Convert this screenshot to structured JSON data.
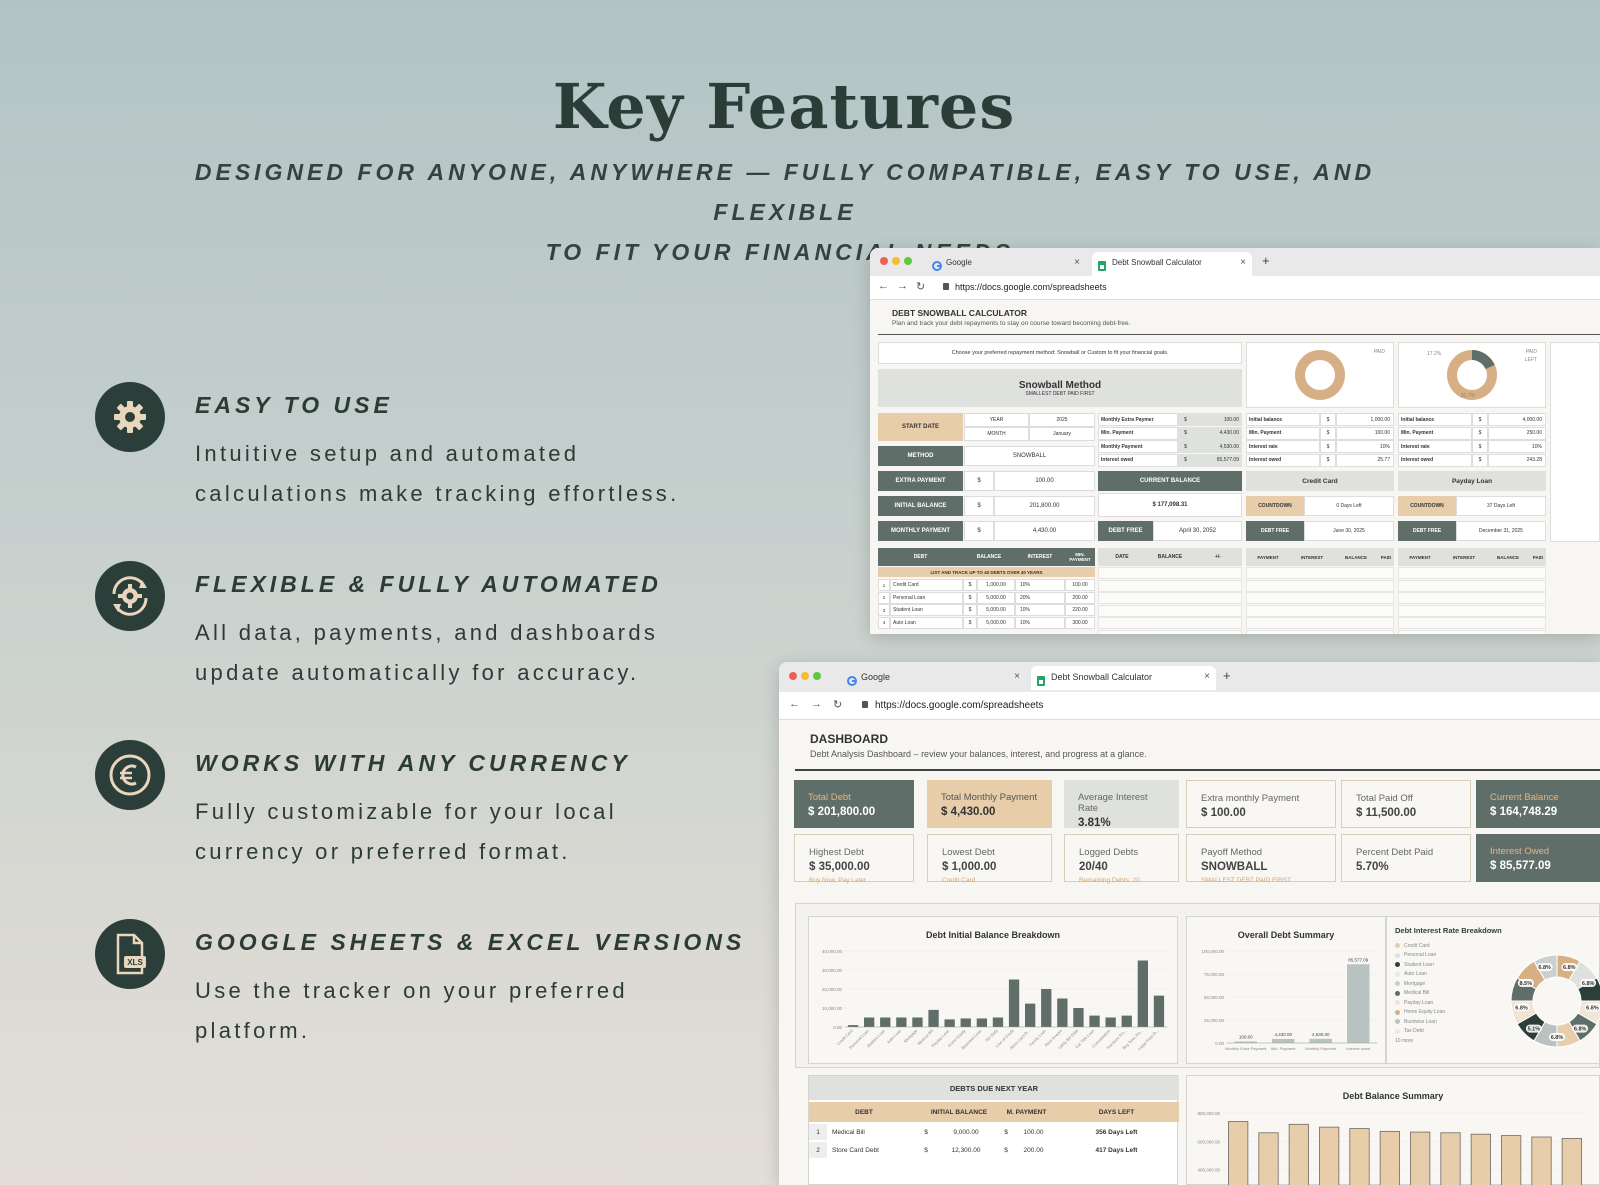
{
  "header": {
    "title": "Key Features",
    "subtitle_line1": "DESIGNED FOR ANYONE, ANYWHERE — FULLY COMPATIBLE, EASY TO USE, AND FLEXIBLE",
    "subtitle_line2": "TO FIT YOUR FINANCIAL NEEDS."
  },
  "features": [
    {
      "icon": "gear-icon",
      "title": "EASY TO USE",
      "line1": "Intuitive setup and automated",
      "line2": "calculations make tracking effortless."
    },
    {
      "icon": "refresh-gear-icon",
      "title": "FLEXIBLE & FULLY AUTOMATED",
      "line1": "All data, payments, and dashboards",
      "line2": "update automatically for accuracy."
    },
    {
      "icon": "euro-icon",
      "title": "WORKS WITH ANY CURRENCY",
      "line1": "Fully customizable for your local",
      "line2": "currency or preferred format."
    },
    {
      "icon": "xls-file-icon",
      "title": "GOOGLE SHEETS & EXCEL VERSIONS",
      "line1": "Use the tracker on your preferred",
      "line2": "platform.",
      "badge": "XLS"
    }
  ],
  "browser": {
    "tab1": "Google",
    "tab2": "Debt Snowball Calculator",
    "url": "https://docs.google.com/spreadsheets"
  },
  "calculator": {
    "title": "DEBT SNOWBALL CALCULATOR",
    "subtitle": "Plan and track your debt repayments to stay on course toward becoming debt-free.",
    "choose_text": "Choose your preferred repayment method: Snowball or Custom to fit your financial goals.",
    "method_title": "Snowball Method",
    "method_sub": "SMALLEST DEBT PAID FIRST",
    "start_date": "START DATE",
    "year_label": "YEAR",
    "year_val": "2025",
    "month_label": "MONTH",
    "month_val": "January",
    "method_label": "METHOD",
    "method_val": "SNOWBALL",
    "extra_payment": "EXTRA PAYMENT",
    "extra_val": "100.00",
    "initial_balance": "INITIAL BALANCE",
    "initial_val": "201,800.00",
    "monthly_payment": "MONTHLY PAYMENT",
    "monthly_val": "4,430.00",
    "currency": "$",
    "summary": [
      {
        "label": "Monthly Extra Paymer",
        "value": "100.00"
      },
      {
        "label": "Min. Payment",
        "value": "4,430.00"
      },
      {
        "label": "Monthly Payment",
        "value": "4,530.00"
      },
      {
        "label": "Interest owed",
        "value": "85,577.09"
      }
    ],
    "current_balance": "CURRENT BALANCE",
    "current_val": "$ 177,098.31",
    "debt_free": "DEBT FREE",
    "debt_free_val": "April 30, 2052",
    "cards": [
      {
        "name": "Credit Card",
        "countdown": "0 Days Left",
        "debt_free": "June 30, 2025",
        "rows": [
          [
            "Initial balance",
            "1,000.00"
          ],
          [
            "Min. Payment",
            "100.00"
          ],
          [
            "Interest rate",
            "10%"
          ],
          [
            "Interest owed",
            "25.77"
          ]
        ]
      },
      {
        "name": "Payday Loan",
        "countdown": "37 Days Left",
        "debt_free": "December 31, 2025",
        "rows": [
          [
            "Initial balance",
            "4,000.00"
          ],
          [
            "Min. Payment",
            "250.00"
          ],
          [
            "Interest rate",
            "10%"
          ],
          [
            "Interest owed",
            "243.28"
          ]
        ]
      }
    ],
    "countdown_label": "COUNTDOWN",
    "legend_paid": "PAID",
    "legend_left": "LEFT",
    "donut_left_pct": "17.2%",
    "donut_paid_pct": "82.7%",
    "debt_table_headers": [
      "DEBT",
      "BALANCE",
      "INTEREST",
      "MIN. PAYMENT"
    ],
    "debt_table_note": "LIST AND TRACK UP TO 40 DEBTS OVER 40 YEARS",
    "debts": [
      {
        "n": "1",
        "name": "Credit Card",
        "bal": "1,000.00",
        "rate": "10%",
        "min": "100.00"
      },
      {
        "n": "2",
        "name": "Personal Loan",
        "bal": "5,000.00",
        "rate": "20%",
        "min": "200.00"
      },
      {
        "n": "3",
        "name": "Student Loan",
        "bal": "5,000.00",
        "rate": "10%",
        "min": "220.00"
      },
      {
        "n": "4",
        "name": "Auto Loan",
        "bal": "5,000.00",
        "rate": "10%",
        "min": "300.00"
      }
    ],
    "sched_headers": [
      "DATE",
      "BALANCE",
      "+/-"
    ],
    "pay_headers": [
      "PAYMENT",
      "INTEREST",
      "BALANCE",
      "PAID"
    ]
  },
  "dashboard": {
    "title": "DASHBOARD",
    "subtitle": "Debt Analysis Dashboard – review your balances, interest, and progress at a glance.",
    "kpis_row1": [
      {
        "label": "Total Debt",
        "value": "$ 201,800.00",
        "style": "dk"
      },
      {
        "label": "Total Monthly Payment",
        "value": "$ 4,430.00",
        "style": "tan"
      },
      {
        "label": "Average Interest Rate",
        "value": "3.81%",
        "style": "gry"
      },
      {
        "label": "Extra monthly Payment",
        "value": "$ 100.00",
        "style": "lt"
      },
      {
        "label": "Total Paid Off",
        "value": "$ 11,500.00",
        "style": "lt"
      },
      {
        "label": "Current Balance",
        "value": "$ 164,748.29",
        "style": "dk"
      }
    ],
    "kpis_row2": [
      {
        "label": "Highest Debt",
        "value": "$ 35,000.00",
        "sub": "Buy Now, Pay Later",
        "style": "lt"
      },
      {
        "label": "Lowest Debt",
        "value": "$ 1,000.00",
        "sub": "Credit Card",
        "style": "lt"
      },
      {
        "label": "Logged Debts",
        "value": "20/40",
        "sub": "Remaining Debts: 20",
        "style": "lt"
      },
      {
        "label": "Payoff Method",
        "value": "SNOWBALL",
        "sub": "SMALLEST DEBT PAID FIRST",
        "style": "lt"
      },
      {
        "label": "Percent Debt Paid",
        "value": "5.70%",
        "sub": "",
        "style": "lt"
      },
      {
        "label": "Interest Owed",
        "value": "$ 85,577.09",
        "style": "dk"
      }
    ],
    "bar_chart_title": "Debt Initial Balance Breakdown",
    "bar_chart_ticks": [
      "40,000.00",
      "30,000.00",
      "20,000.00",
      "10,000.00",
      "0.00"
    ],
    "summary_chart_title": "Overall Debt Summary",
    "summary_ticks": [
      "100,000.00",
      "75,000.00",
      "50,000.00",
      "25,000.00",
      "0.00"
    ],
    "summary_labels": [
      "Monthly Extra Payment",
      "Min. Payment",
      "Monthly Payment",
      "Interest owed"
    ],
    "summary_values": [
      "100.00",
      "4,430.00",
      "4,530.00",
      "85,577.09"
    ],
    "pie_title": "Debt Interest Rate Breakdown",
    "pie_legend": [
      "Credit Card",
      "Personal Loan",
      "Student Loan",
      "Auto Loan",
      "Mortgage",
      "Medical Bill",
      "Payday Loan",
      "Home Equity Loan",
      "Business Loan",
      "Tax Debt"
    ],
    "pie_more": "10 more",
    "pie_labels": [
      "6.8%",
      "6.8%",
      "6.8%",
      "6.8%",
      "6.8%",
      "5.1%",
      "6.8%",
      "8.5%",
      "6.8%"
    ],
    "due_title": "DEBTS DUE NEXT YEAR",
    "due_headers": [
      "DEBT",
      "INITIAL BALANCE",
      "M. PAYMENT",
      "DAYS LEFT"
    ],
    "due_rows": [
      {
        "n": "1",
        "name": "Medical Bill",
        "bal": "9,000.00",
        "pay": "100.00",
        "days": "356 Days Left"
      },
      {
        "n": "2",
        "name": "Store Card Debt",
        "bal": "12,300.00",
        "pay": "200.00",
        "days": "417 Days Left"
      }
    ],
    "balance_title": "Debt Balance Summary",
    "balance_ticks": [
      "800,000.00",
      "600,000.00",
      "400,000.00",
      "200,000.00"
    ]
  },
  "chart_data": [
    {
      "type": "bar",
      "title": "Debt Initial Balance Breakdown",
      "categories": [
        "Credit Card",
        "Personal Loan",
        "Student Loan",
        "Auto Loan",
        "Mortgage",
        "Medical Bill",
        "Payday Loan",
        "Home Equity",
        "Business Loan",
        "Tax Debt",
        "Line of Credit",
        "Store Card D...",
        "Family Loan",
        "Rent Arrears",
        "Utility Bill Debt",
        "Car Title Loan",
        "Consolidation",
        "Furniture Fin...",
        "Buy Now, Pa...",
        "Legal Fees D..."
      ],
      "values": [
        1000,
        5000,
        5000,
        5000,
        5000,
        9000,
        4000,
        4500,
        4500,
        5000,
        25000,
        12300,
        20000,
        15000,
        10000,
        6000,
        5000,
        6000,
        35000,
        16500
      ],
      "ylim": [
        0,
        40000
      ],
      "color": "#5f6e68"
    },
    {
      "type": "bar",
      "title": "Overall Debt Summary",
      "categories": [
        "Monthly Extra Payment",
        "Min. Payment",
        "Monthly Payment",
        "Interest owed"
      ],
      "values": [
        100,
        4430,
        4530,
        85577.09
      ],
      "ylim": [
        0,
        100000
      ],
      "color": "#b7c2c1"
    },
    {
      "type": "bar",
      "title": "Debt Balance Summary",
      "values": [
        740000,
        660000,
        720000,
        700000,
        690000,
        670000,
        665000,
        660000,
        650000,
        640000,
        630000,
        620000
      ],
      "ylim": [
        0,
        800000
      ],
      "color": "#e7cda9"
    }
  ],
  "colors": {
    "dark": "#2c3e39",
    "sage": "#5f6e68",
    "tan": "#e7cda9",
    "accent": "#d9a36a"
  }
}
